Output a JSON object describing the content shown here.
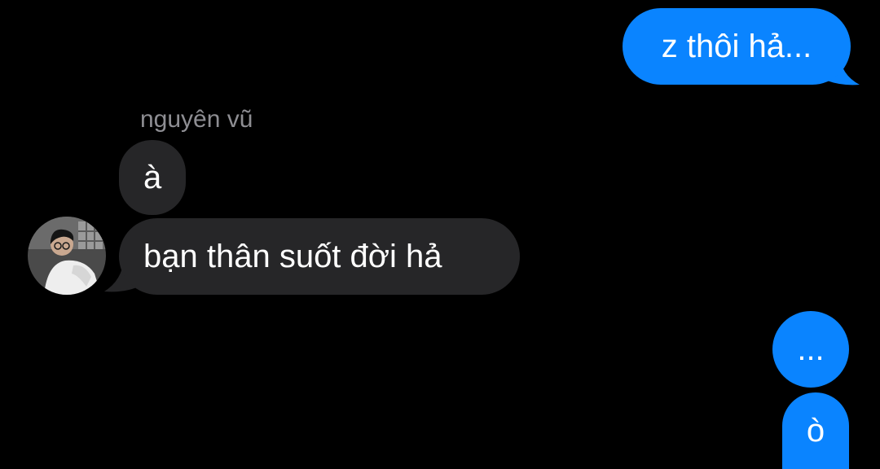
{
  "conversation": {
    "contact_name": "nguyên vũ",
    "messages": [
      {
        "direction": "outgoing",
        "text": "z thôi hả..."
      },
      {
        "direction": "incoming",
        "text": "à"
      },
      {
        "direction": "incoming",
        "text": "bạn thân suốt đời hả"
      },
      {
        "direction": "outgoing",
        "text": "..."
      },
      {
        "direction": "outgoing",
        "text": "ò"
      }
    ]
  },
  "colors": {
    "background": "#000000",
    "outgoing_bubble": "#0a84ff",
    "incoming_bubble": "#262628",
    "sender_name": "#8e8e93",
    "message_text": "#ffffff"
  },
  "icons": {
    "avatar": "contact-avatar-photo"
  }
}
